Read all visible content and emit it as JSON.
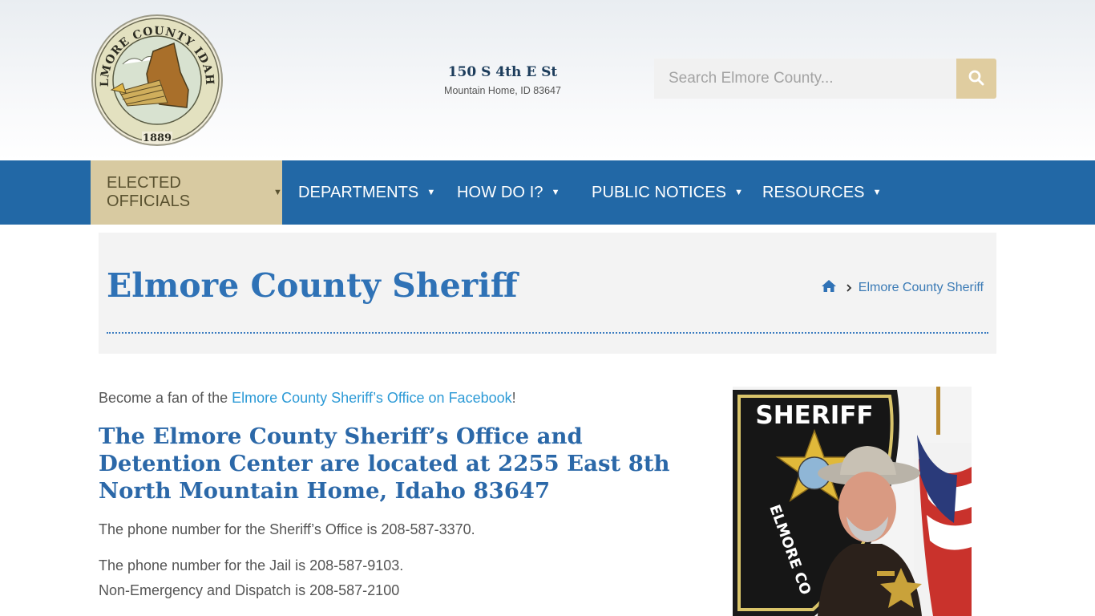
{
  "header": {
    "logo": {
      "arc_text": "ELMORE COUNTY IDAHO",
      "year": "1889"
    },
    "address_street": "150 S 4th E St",
    "address_city": "Mountain Home, ID 83647",
    "search_placeholder": "Search Elmore County...",
    "search_icon": "search-icon"
  },
  "nav": {
    "items": [
      {
        "label": "ELECTED OFFICIALS",
        "active": true
      },
      {
        "label": "DEPARTMENTS",
        "active": false
      },
      {
        "label": "HOW DO I?",
        "active": false
      },
      {
        "label": "PUBLIC NOTICES",
        "active": false
      },
      {
        "label": "RESOURCES",
        "active": false
      }
    ],
    "caret": "▼"
  },
  "title_banner": {
    "title": "Elmore County Sheriff",
    "breadcrumb_home_icon": "home-icon",
    "breadcrumb_current": "Elmore County Sheriff"
  },
  "content": {
    "fan_prefix": "Become a fan of the ",
    "fan_link": "Elmore County Sheriff’s Office on Facebook",
    "fan_suffix": "!",
    "location_heading": "The Elmore County Sheriff’s Office and Detention Center are located at 2255 East 8th North Mountain Home, Idaho 83647",
    "office_phone": "The phone number for the Sheriff’s Office is 208-587-3370.",
    "jail_phone": "The phone number for the Jail is 208-587-9103.",
    "dispatch_phone": "Non-Emergency and Dispatch is 208-587-2100"
  },
  "photo": {
    "patch_text": "SHERIFF",
    "patch_arc_text": "ELMORE CO"
  },
  "colors": {
    "nav_blue": "#2268a6",
    "nav_active": "#d8caa1",
    "title_blue": "#2f72b6",
    "link_blue": "#2c9ad6",
    "search_button": "#e0cda0"
  }
}
